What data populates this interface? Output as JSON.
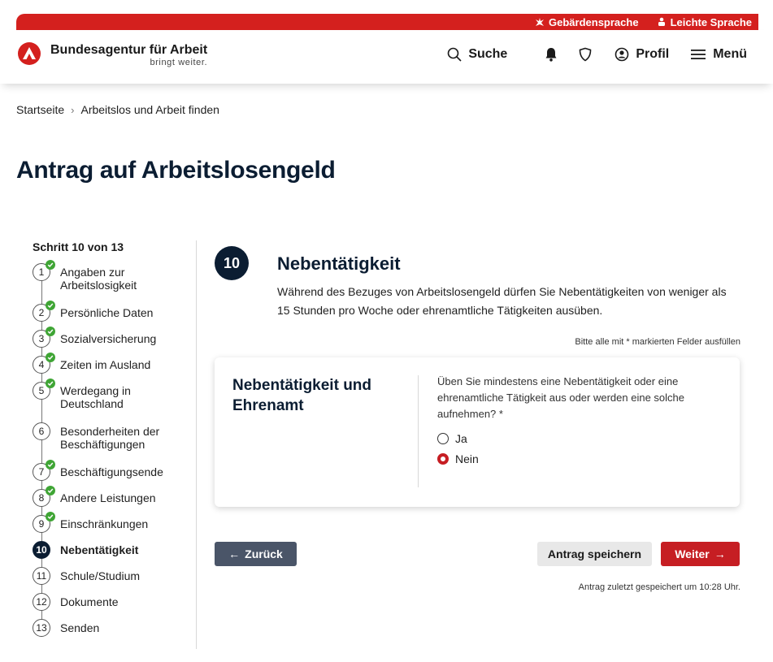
{
  "topbar": {
    "sign_language": "Gebärdensprache",
    "easy_language": "Leichte Sprache"
  },
  "header": {
    "brand_name": "Bundesagentur für Arbeit",
    "brand_claim": "bringt weiter.",
    "search_label": "Suche",
    "profile_label": "Profil",
    "menu_label": "Menü"
  },
  "breadcrumb": {
    "home": "Startseite",
    "current": "Arbeitslos und Arbeit finden"
  },
  "page_title": "Antrag auf Arbeitslosengeld",
  "stepper": {
    "label": "Schritt 10 von 13",
    "steps": [
      {
        "number": "1",
        "label": "Angaben zur Arbeitslosigkeit",
        "done": true
      },
      {
        "number": "2",
        "label": "Persönliche Daten",
        "done": true
      },
      {
        "number": "3",
        "label": "Sozialversicherung",
        "done": true
      },
      {
        "number": "4",
        "label": "Zeiten im Ausland",
        "done": true
      },
      {
        "number": "5",
        "label": "Werdegang in Deutschland",
        "done": true
      },
      {
        "number": "6",
        "label": "Besonderheiten der Beschäftigungen",
        "done": false
      },
      {
        "number": "7",
        "label": "Beschäftigungsende",
        "done": true
      },
      {
        "number": "8",
        "label": "Andere Leistungen",
        "done": true
      },
      {
        "number": "9",
        "label": "Einschränkungen",
        "done": true
      },
      {
        "number": "10",
        "label": "Nebentätigkeit",
        "done": false,
        "active": true
      },
      {
        "number": "11",
        "label": "Schule/Studium",
        "done": false
      },
      {
        "number": "12",
        "label": "Dokumente",
        "done": false
      },
      {
        "number": "13",
        "label": "Senden",
        "done": false
      }
    ]
  },
  "section": {
    "number": "10",
    "title": "Nebentätigkeit",
    "description": "Während des Bezuges von Arbeitslosengeld dürfen Sie Nebentätigkeiten von weniger als 15 Stunden pro Woche oder ehrenamtliche Tätigkeiten ausüben.",
    "required_note": "Bitte alle mit * markierten Felder ausfüllen"
  },
  "card": {
    "title": "Nebentätigkeit und Ehrenamt",
    "question": "Üben Sie mindestens eine Nebentätigkeit oder eine ehrenamtliche Tätigkeit aus oder werden eine solche aufnehmen? *",
    "options": [
      {
        "label": "Ja",
        "checked": false
      },
      {
        "label": "Nein",
        "checked": true
      }
    ]
  },
  "actions": {
    "back_label": "Zurück",
    "save_label": "Antrag speichern",
    "next_label": "Weiter",
    "saved_note": "Antrag zuletzt gespeichert um 10:28 Uhr."
  },
  "colors": {
    "brand_red": "#d4201e",
    "navy": "#0b1d32",
    "success_green": "#3fa535",
    "secondary_gray": "#4a5568"
  }
}
